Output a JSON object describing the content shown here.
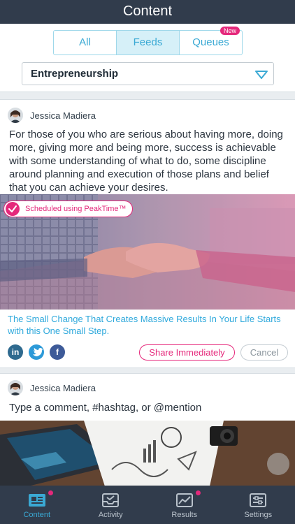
{
  "header": {
    "title": "Content"
  },
  "segments": {
    "all": "All",
    "feeds": "Feeds",
    "queues": "Queues",
    "queues_badge": "New",
    "active": "Feeds"
  },
  "filter": {
    "selected": "Entrepreneurship"
  },
  "posts": [
    {
      "author": "Jessica Madiera",
      "text": "For those of you who are serious about having more, doing more, giving more and being more, success is achievable with some understanding of what to do, some discipline around planning and execution of those plans and belief that you can achieve your desires.",
      "scheduled_label": "Scheduled using PeakTime™",
      "link_title": "The Small Change That Creates Massive Results In Your Life Starts with this One Small Step.",
      "social": {
        "linkedin": "in",
        "twitter": "t",
        "facebook": "f"
      },
      "share_label": "Share Immediately",
      "cancel_label": "Cancel"
    },
    {
      "author": "Jessica Madiera",
      "comment_placeholder": "Type a comment, #hashtag, or @mention"
    }
  ],
  "tabs": [
    {
      "label": "Content",
      "icon": "newspaper-icon",
      "badge": true
    },
    {
      "label": "Activity",
      "icon": "inbox-icon",
      "badge": false
    },
    {
      "label": "Results",
      "icon": "chart-icon",
      "badge": true
    },
    {
      "label": "Settings",
      "icon": "sliders-icon",
      "badge": false
    }
  ],
  "colors": {
    "accent": "#3aa9d4",
    "brand_pink": "#e5287b",
    "header": "#313c4c"
  }
}
